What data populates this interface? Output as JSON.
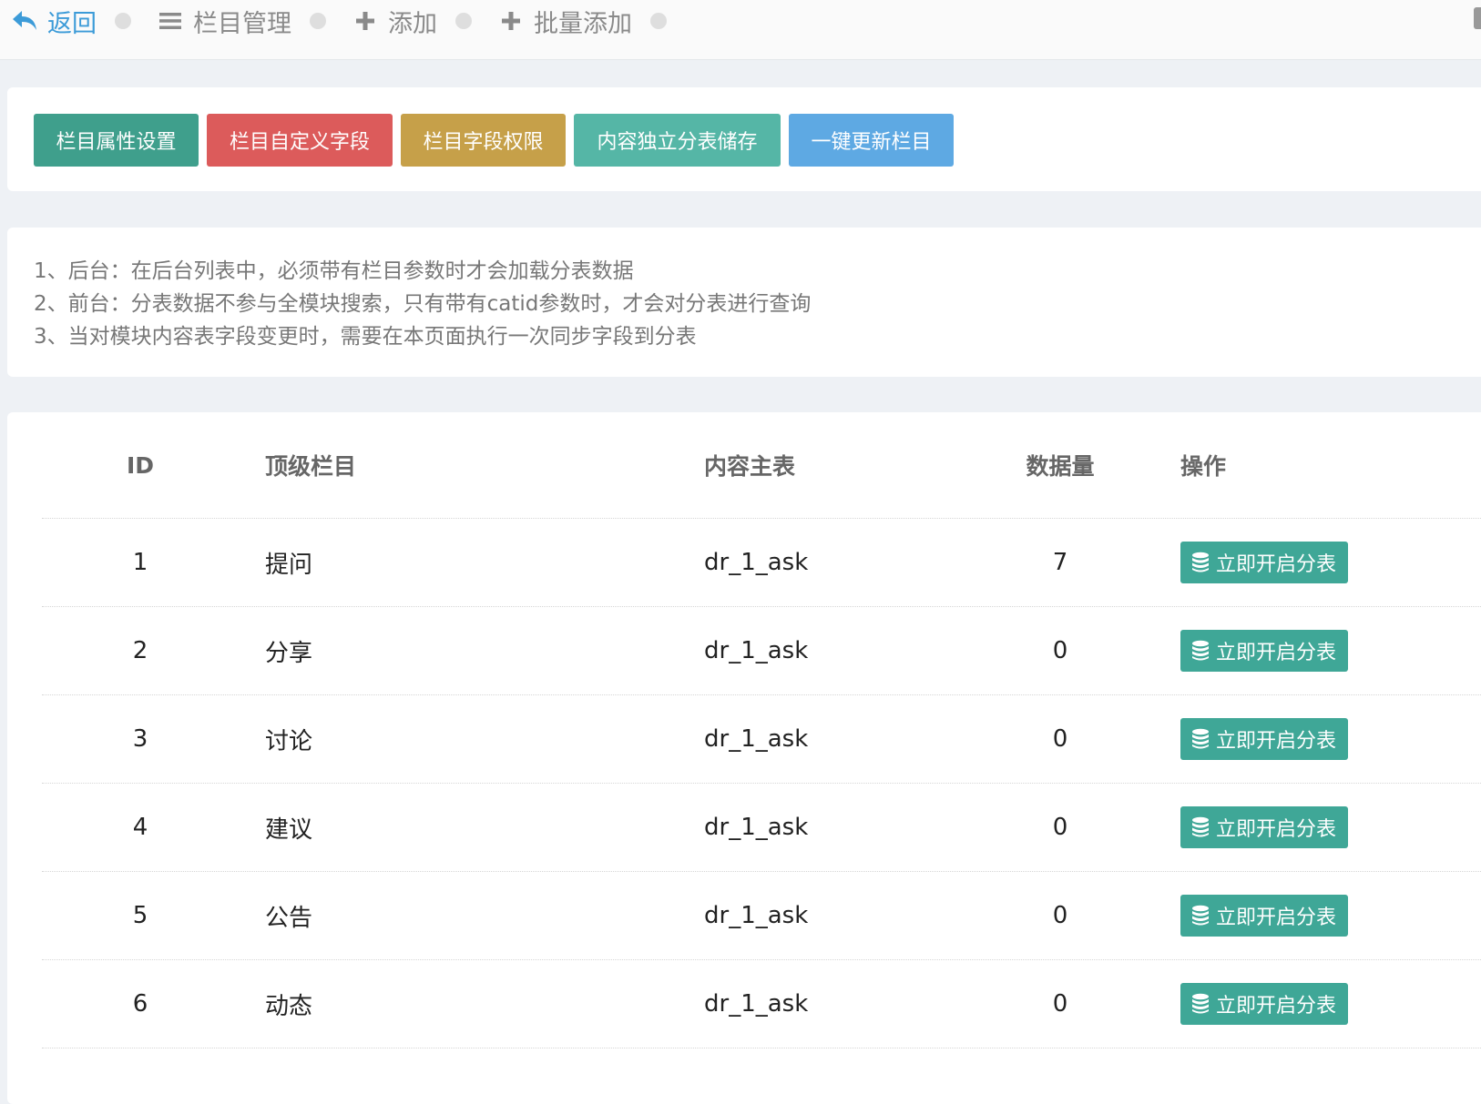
{
  "nav": {
    "back": "返回",
    "manage": "栏目管理",
    "add": "添加",
    "batch_add": "批量添加"
  },
  "toolbar": {
    "buttons": [
      {
        "label": "栏目属性设置",
        "color": "#3f9f8c"
      },
      {
        "label": "栏目自定义字段",
        "color": "#dc5b5b"
      },
      {
        "label": "栏目字段权限",
        "color": "#c6a049"
      },
      {
        "label": "内容独立分表储存",
        "color": "#55b6a6"
      },
      {
        "label": "一键更新栏目",
        "color": "#5ea9e3"
      }
    ]
  },
  "notes": [
    "1、后台：在后台列表中，必须带有栏目参数时才会加载分表数据",
    "2、前台：分表数据不参与全模块搜索，只有带有catid参数时，才会对分表进行查询",
    "3、当对模块内容表字段变更时，需要在本页面执行一次同步字段到分表"
  ],
  "table": {
    "headers": {
      "id": "ID",
      "name": "顶级栏目",
      "table": "内容主表",
      "count": "数据量",
      "op": "操作"
    },
    "rows": [
      {
        "id": "1",
        "name": "提问",
        "table": "dr_1_ask",
        "count": "7",
        "op": "立即开启分表"
      },
      {
        "id": "2",
        "name": "分享",
        "table": "dr_1_ask",
        "count": "0",
        "op": "立即开启分表"
      },
      {
        "id": "3",
        "name": "讨论",
        "table": "dr_1_ask",
        "count": "0",
        "op": "立即开启分表"
      },
      {
        "id": "4",
        "name": "建议",
        "table": "dr_1_ask",
        "count": "0",
        "op": "立即开启分表"
      },
      {
        "id": "5",
        "name": "公告",
        "table": "dr_1_ask",
        "count": "0",
        "op": "立即开启分表"
      },
      {
        "id": "6",
        "name": "动态",
        "table": "dr_1_ask",
        "count": "0",
        "op": "立即开启分表"
      }
    ]
  },
  "icons": {
    "back": "reply-arrow-icon",
    "manage": "list-icon",
    "add": "plus-icon",
    "batch_add": "plus-icon",
    "op": "database-icon"
  },
  "colors": {
    "accent": "#3c9bd8",
    "op_button": "#3fa797"
  }
}
